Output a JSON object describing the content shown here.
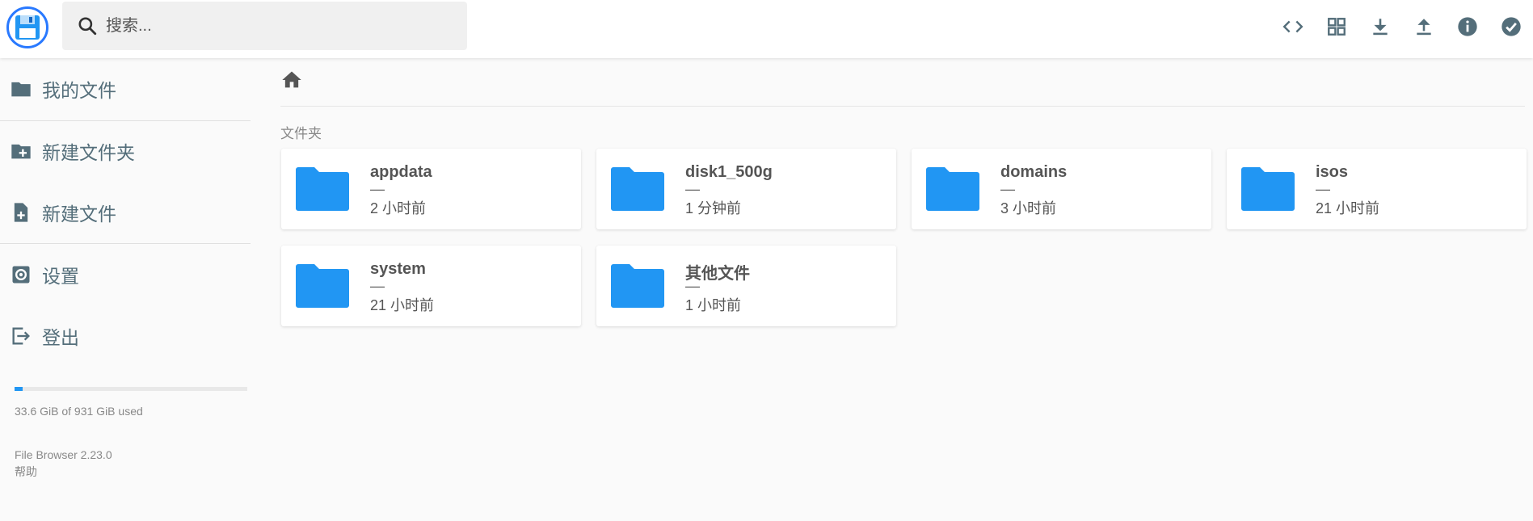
{
  "header": {
    "search_placeholder": "搜索..."
  },
  "sidebar": {
    "items": [
      {
        "label": "我的文件",
        "icon": "folder-icon"
      },
      {
        "label": "新建文件夹",
        "icon": "new-folder-icon"
      },
      {
        "label": "新建文件",
        "icon": "new-file-icon"
      },
      {
        "label": "设置",
        "icon": "settings-icon"
      },
      {
        "label": "登出",
        "icon": "logout-icon"
      }
    ],
    "usage_text": "33.6 GiB of 931 GiB used",
    "usage_fraction": 0.036,
    "version": "File Browser 2.23.0",
    "help": "帮助"
  },
  "main": {
    "section_title": "文件夹",
    "folders": [
      {
        "name": "appdata",
        "size": "—",
        "modified": "2 小时前"
      },
      {
        "name": "disk1_500g",
        "size": "—",
        "modified": "1 分钟前"
      },
      {
        "name": "domains",
        "size": "—",
        "modified": "3 小时前"
      },
      {
        "name": "isos",
        "size": "—",
        "modified": "21 小时前"
      },
      {
        "name": "system",
        "size": "—",
        "modified": "21 小时前"
      },
      {
        "name": "其他文件",
        "size": "—",
        "modified": "1 小时前"
      }
    ]
  },
  "colors": {
    "accent": "#2196f3",
    "logo_ring": "#2979ff",
    "icon": "#546e7a"
  }
}
